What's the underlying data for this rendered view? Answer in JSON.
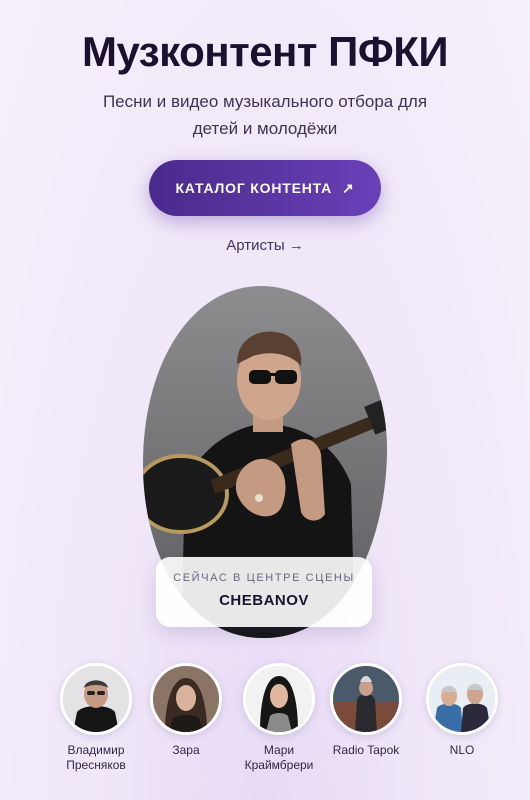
{
  "header": {
    "title": "Музконтент ПФКИ",
    "subtitle": "Песни и видео музыкального отбора для детей и молодёжи"
  },
  "cta": {
    "label": "КАТАЛОГ КОНТЕНТА",
    "arrow": "↗"
  },
  "artists_link": {
    "label": "Артисты →"
  },
  "featured": {
    "label": "СЕЙЧАС В ЦЕНТРЕ СЦЕНЫ",
    "name": "CHEBANOV"
  },
  "artists": [
    {
      "name": "Владимир Пресняков"
    },
    {
      "name": "Зара"
    },
    {
      "name": "Мари Краймбрери"
    },
    {
      "name": "Radio Tapok"
    },
    {
      "name": "NLO"
    }
  ]
}
